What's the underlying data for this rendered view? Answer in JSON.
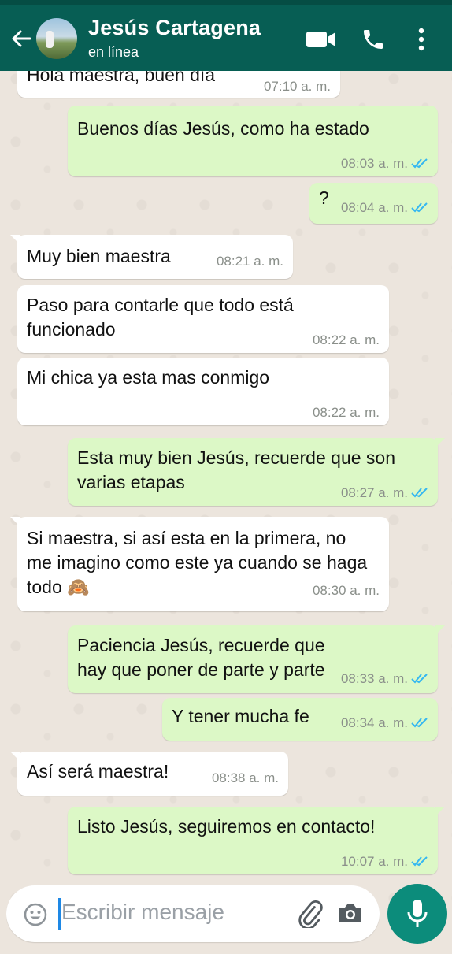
{
  "header": {
    "contact_name": "Jesús Cartagena",
    "contact_status": "en línea",
    "colors": {
      "bar": "#075e54",
      "outgoing": "#dcf8c6",
      "incoming": "#ffffff",
      "read_ticks": "#34b7f1"
    }
  },
  "messages": [
    {
      "dir": "in",
      "text": "Hola maestra, buen día",
      "time": "07:10 a. m."
    },
    {
      "dir": "out",
      "text": "Buenos días Jesús, como ha estado",
      "time": "08:03 a. m.",
      "status": "read"
    },
    {
      "dir": "out",
      "text": "?",
      "time": "08:04 a. m.",
      "status": "read"
    },
    {
      "dir": "in",
      "text": "Muy bien maestra",
      "time": "08:21 a. m."
    },
    {
      "dir": "in",
      "text": "Paso para contarle que todo está funcionado",
      "time": "08:22 a. m."
    },
    {
      "dir": "in",
      "text": "Mi chica ya esta mas conmigo",
      "time": "08:22 a. m."
    },
    {
      "dir": "out",
      "text": "Esta muy bien Jesús, recuerde que son varias etapas",
      "time": "08:27 a. m.",
      "status": "read"
    },
    {
      "dir": "in",
      "text": "Si maestra, si así esta en la primera, no me imagino como este ya cuando se haga todo 🙈",
      "time": "08:30 a. m."
    },
    {
      "dir": "out",
      "text": "Paciencia Jesús, recuerde que hay que poner de parte y parte",
      "time": "08:33 a. m.",
      "status": "read"
    },
    {
      "dir": "out",
      "text": "Y tener mucha fe",
      "time": "08:34 a. m.",
      "status": "read"
    },
    {
      "dir": "in",
      "text": "Así será maestra!",
      "time": "08:38 a. m."
    },
    {
      "dir": "out",
      "text": "Listo Jesús, seguiremos en contacto!",
      "time": "10:07 a. m.",
      "status": "read"
    }
  ],
  "composer": {
    "placeholder": "Escribir mensaje",
    "icons": [
      "emoji-icon",
      "paperclip-icon",
      "camera-icon",
      "microphone-icon"
    ]
  }
}
